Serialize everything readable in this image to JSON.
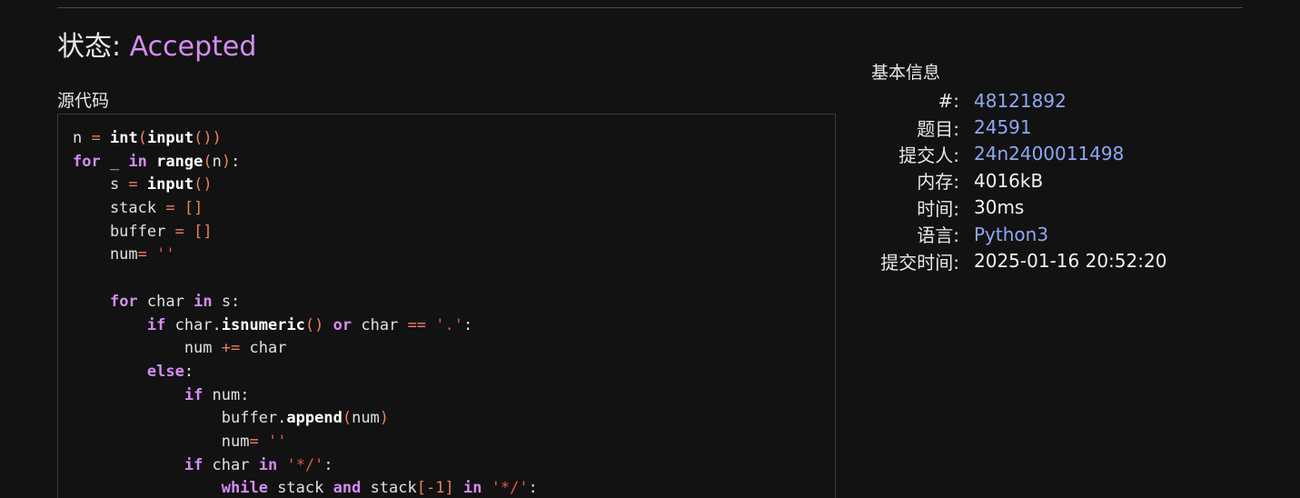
{
  "status": {
    "label": "状态: ",
    "value": "Accepted"
  },
  "source": {
    "label": "源代码",
    "code_lines": [
      [
        [
          "n ",
          "plain"
        ],
        [
          "=",
          "op"
        ],
        [
          " ",
          "plain"
        ],
        [
          "int",
          "fn"
        ],
        [
          "(",
          "op"
        ],
        [
          "input",
          "fn"
        ],
        [
          "())",
          "op"
        ]
      ],
      [
        [
          "for",
          "kw"
        ],
        [
          " _ ",
          "plain"
        ],
        [
          "in",
          "kw"
        ],
        [
          " ",
          "plain"
        ],
        [
          "range",
          "fn"
        ],
        [
          "(",
          "op"
        ],
        [
          "n",
          "plain"
        ],
        [
          ")",
          "op"
        ],
        [
          ":",
          "plain"
        ]
      ],
      [
        [
          "    s ",
          "plain"
        ],
        [
          "=",
          "op"
        ],
        [
          " ",
          "plain"
        ],
        [
          "input",
          "fn"
        ],
        [
          "()",
          "op"
        ]
      ],
      [
        [
          "    stack ",
          "plain"
        ],
        [
          "=",
          "op"
        ],
        [
          " ",
          "plain"
        ],
        [
          "[]",
          "op"
        ]
      ],
      [
        [
          "    buffer ",
          "plain"
        ],
        [
          "=",
          "op"
        ],
        [
          " ",
          "plain"
        ],
        [
          "[]",
          "op"
        ]
      ],
      [
        [
          "    num",
          "plain"
        ],
        [
          "=",
          "op"
        ],
        [
          " ",
          "plain"
        ],
        [
          "''",
          "str"
        ]
      ],
      [
        [
          "",
          "plain"
        ]
      ],
      [
        [
          "    ",
          "plain"
        ],
        [
          "for",
          "kw"
        ],
        [
          " char ",
          "plain"
        ],
        [
          "in",
          "kw"
        ],
        [
          " s:",
          "plain"
        ]
      ],
      [
        [
          "        ",
          "plain"
        ],
        [
          "if",
          "kw"
        ],
        [
          " char.",
          "plain"
        ],
        [
          "isnumeric",
          "fn"
        ],
        [
          "()",
          "op"
        ],
        [
          " ",
          "plain"
        ],
        [
          "or",
          "kw"
        ],
        [
          " char ",
          "plain"
        ],
        [
          "==",
          "op"
        ],
        [
          " ",
          "plain"
        ],
        [
          "'.'",
          "str"
        ],
        [
          ":",
          "plain"
        ]
      ],
      [
        [
          "            num ",
          "plain"
        ],
        [
          "+=",
          "op"
        ],
        [
          " char",
          "plain"
        ]
      ],
      [
        [
          "        ",
          "plain"
        ],
        [
          "else",
          "kw"
        ],
        [
          ":",
          "plain"
        ]
      ],
      [
        [
          "            ",
          "plain"
        ],
        [
          "if",
          "kw"
        ],
        [
          " num:",
          "plain"
        ]
      ],
      [
        [
          "                buffer.",
          "plain"
        ],
        [
          "append",
          "fn"
        ],
        [
          "(",
          "op"
        ],
        [
          "num",
          "plain"
        ],
        [
          ")",
          "op"
        ]
      ],
      [
        [
          "                num",
          "plain"
        ],
        [
          "=",
          "op"
        ],
        [
          " ",
          "plain"
        ],
        [
          "''",
          "str"
        ]
      ],
      [
        [
          "            ",
          "plain"
        ],
        [
          "if",
          "kw"
        ],
        [
          " char ",
          "plain"
        ],
        [
          "in",
          "kw"
        ],
        [
          " ",
          "plain"
        ],
        [
          "'*/'",
          "str"
        ],
        [
          ":",
          "plain"
        ]
      ],
      [
        [
          "                ",
          "plain"
        ],
        [
          "while",
          "kw"
        ],
        [
          " stack ",
          "plain"
        ],
        [
          "and",
          "kw"
        ],
        [
          " stack",
          "plain"
        ],
        [
          "[-1]",
          "op"
        ],
        [
          " ",
          "plain"
        ],
        [
          "in",
          "kw"
        ],
        [
          " ",
          "plain"
        ],
        [
          "'*/'",
          "str"
        ],
        [
          ":",
          "plain"
        ]
      ]
    ]
  },
  "info": {
    "title": "基本信息",
    "rows": [
      {
        "key": "#:",
        "value": "48121892",
        "link": true
      },
      {
        "key": "题目:",
        "value": "24591",
        "link": true
      },
      {
        "key": "提交人:",
        "value": "24n2400011498",
        "link": true
      },
      {
        "key": "内存:",
        "value": "4016kB",
        "link": false
      },
      {
        "key": "时间:",
        "value": "30ms",
        "link": false
      },
      {
        "key": "语言:",
        "value": "Python3",
        "link": true
      },
      {
        "key": "提交时间:",
        "value": "2025-01-16 20:52:20",
        "link": false
      }
    ]
  },
  "colors": {
    "background": "#121212",
    "accepted": "#d48cf2",
    "link": "#8fa8f5",
    "keyword": "#d48cf2",
    "operator": "#ef7f5f",
    "string": "#e05a4a"
  }
}
